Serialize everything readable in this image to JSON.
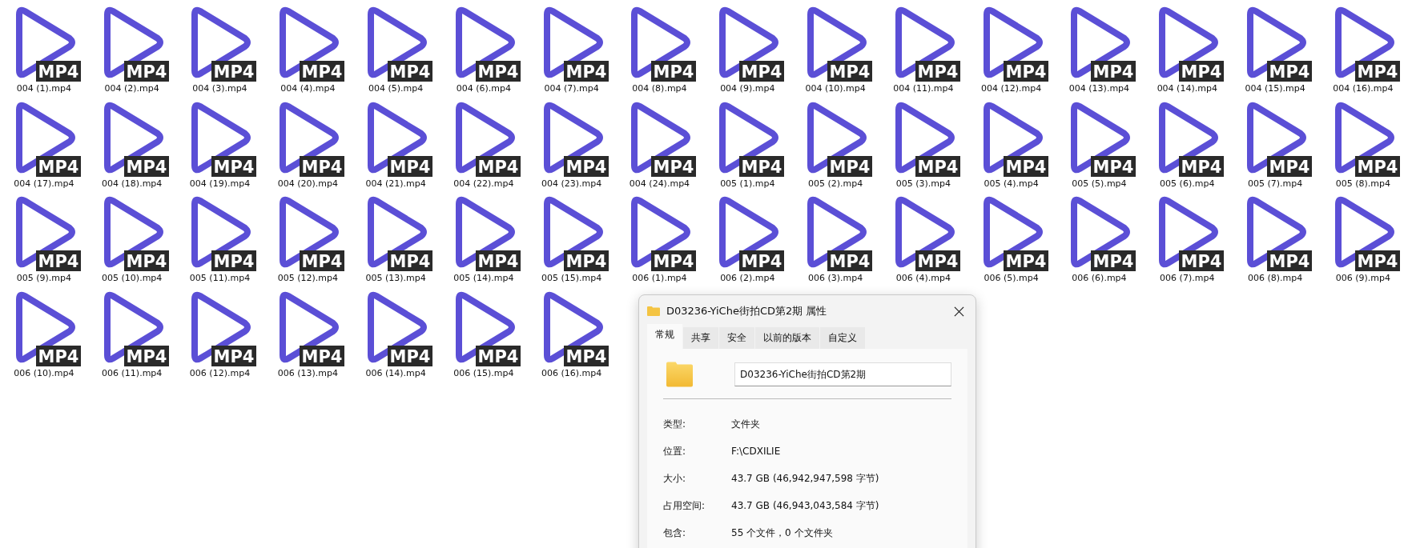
{
  "files": [
    {
      "name": "004 (1).mp4",
      "badge": "MP4"
    },
    {
      "name": "004 (2).mp4",
      "badge": "MP4"
    },
    {
      "name": "004 (3).mp4",
      "badge": "MP4"
    },
    {
      "name": "004 (4).mp4",
      "badge": "MP4"
    },
    {
      "name": "004 (5).mp4",
      "badge": "MP4"
    },
    {
      "name": "004 (6).mp4",
      "badge": "MP4"
    },
    {
      "name": "004 (7).mp4",
      "badge": "MP4"
    },
    {
      "name": "004 (8).mp4",
      "badge": "MP4"
    },
    {
      "name": "004 (9).mp4",
      "badge": "MP4"
    },
    {
      "name": "004 (10).mp4",
      "badge": "MP4"
    },
    {
      "name": "004 (11).mp4",
      "badge": "MP4"
    },
    {
      "name": "004 (12).mp4",
      "badge": "MP4"
    },
    {
      "name": "004 (13).mp4",
      "badge": "MP4"
    },
    {
      "name": "004 (14).mp4",
      "badge": "MP4"
    },
    {
      "name": "004 (15).mp4",
      "badge": "MP4"
    },
    {
      "name": "004 (16).mp4",
      "badge": "MP4"
    },
    {
      "name": "004 (17).mp4",
      "badge": "MP4"
    },
    {
      "name": "004 (18).mp4",
      "badge": "MP4"
    },
    {
      "name": "004 (19).mp4",
      "badge": "MP4"
    },
    {
      "name": "004 (20).mp4",
      "badge": "MP4"
    },
    {
      "name": "004 (21).mp4",
      "badge": "MP4"
    },
    {
      "name": "004 (22).mp4",
      "badge": "MP4"
    },
    {
      "name": "004 (23).mp4",
      "badge": "MP4"
    },
    {
      "name": "004 (24).mp4",
      "badge": "MP4"
    },
    {
      "name": "005 (1).mp4",
      "badge": "MP4"
    },
    {
      "name": "005 (2).mp4",
      "badge": "MP4"
    },
    {
      "name": "005 (3).mp4",
      "badge": "MP4"
    },
    {
      "name": "005 (4).mp4",
      "badge": "MP4"
    },
    {
      "name": "005 (5).mp4",
      "badge": "MP4"
    },
    {
      "name": "005 (6).mp4",
      "badge": "MP4"
    },
    {
      "name": "005 (7).mp4",
      "badge": "MP4"
    },
    {
      "name": "005 (8).mp4",
      "badge": "MP4"
    },
    {
      "name": "005 (9).mp4",
      "badge": "MP4"
    },
    {
      "name": "005 (10).mp4",
      "badge": "MP4"
    },
    {
      "name": "005 (11).mp4",
      "badge": "MP4"
    },
    {
      "name": "005 (12).mp4",
      "badge": "MP4"
    },
    {
      "name": "005 (13).mp4",
      "badge": "MP4"
    },
    {
      "name": "005 (14).mp4",
      "badge": "MP4"
    },
    {
      "name": "005 (15).mp4",
      "badge": "MP4"
    },
    {
      "name": "006 (1).mp4",
      "badge": "MP4"
    },
    {
      "name": "006 (2).mp4",
      "badge": "MP4"
    },
    {
      "name": "006 (3).mp4",
      "badge": "MP4"
    },
    {
      "name": "006 (4).mp4",
      "badge": "MP4"
    },
    {
      "name": "006 (5).mp4",
      "badge": "MP4"
    },
    {
      "name": "006 (6).mp4",
      "badge": "MP4"
    },
    {
      "name": "006 (7).mp4",
      "badge": "MP4"
    },
    {
      "name": "006 (8).mp4",
      "badge": "MP4"
    },
    {
      "name": "006 (9).mp4",
      "badge": "MP4"
    },
    {
      "name": "006 (10).mp4",
      "badge": "MP4"
    },
    {
      "name": "006 (11).mp4",
      "badge": "MP4"
    },
    {
      "name": "006 (12).mp4",
      "badge": "MP4"
    },
    {
      "name": "006 (13).mp4",
      "badge": "MP4"
    },
    {
      "name": "006 (14).mp4",
      "badge": "MP4"
    },
    {
      "name": "006 (15).mp4",
      "badge": "MP4"
    },
    {
      "name": "006 (16).mp4",
      "badge": "MP4"
    }
  ],
  "dialog": {
    "title": "D03236-YiChe街拍CD第2期 属性",
    "tabs": [
      {
        "label": "常规",
        "selected": true
      },
      {
        "label": "共享",
        "selected": false
      },
      {
        "label": "安全",
        "selected": false
      },
      {
        "label": "以前的版本",
        "selected": false
      },
      {
        "label": "自定义",
        "selected": false
      }
    ],
    "name_field": {
      "value": "D03236-YiChe街拍CD第2期"
    },
    "properties": [
      {
        "label": "类型:",
        "value": "文件夹"
      },
      {
        "label": "位置:",
        "value": "F:\\CDXILIE"
      },
      {
        "label": "大小:",
        "value": "43.7 GB (46,942,947,598 字节)"
      },
      {
        "label": "占用空间:",
        "value": "43.7 GB (46,943,043,584 字节)"
      },
      {
        "label": "包含:",
        "value": "55 个文件，0 个文件夹"
      }
    ]
  }
}
